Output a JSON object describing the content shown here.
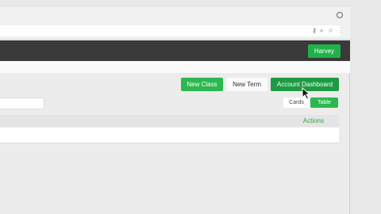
{
  "browser": {
    "icons": [
      "account-icon",
      "key-icon",
      "zoom-icon",
      "bookmark-star-icon",
      "menu-icon"
    ]
  },
  "appbar": {
    "user_label": "Harvey"
  },
  "toolbar": {
    "new_class_label": "New Class",
    "new_term_label": "New Term",
    "account_dashboard_label": "Account Dashboard"
  },
  "view_toggle": {
    "cards_label": "Cards",
    "table_label": "Table",
    "selected": "Table"
  },
  "table": {
    "actions_header": "Actions"
  },
  "colors": {
    "accent": "#2cb84f",
    "accent_dark": "#1f9a44",
    "appbar": "#3a3a3a"
  }
}
